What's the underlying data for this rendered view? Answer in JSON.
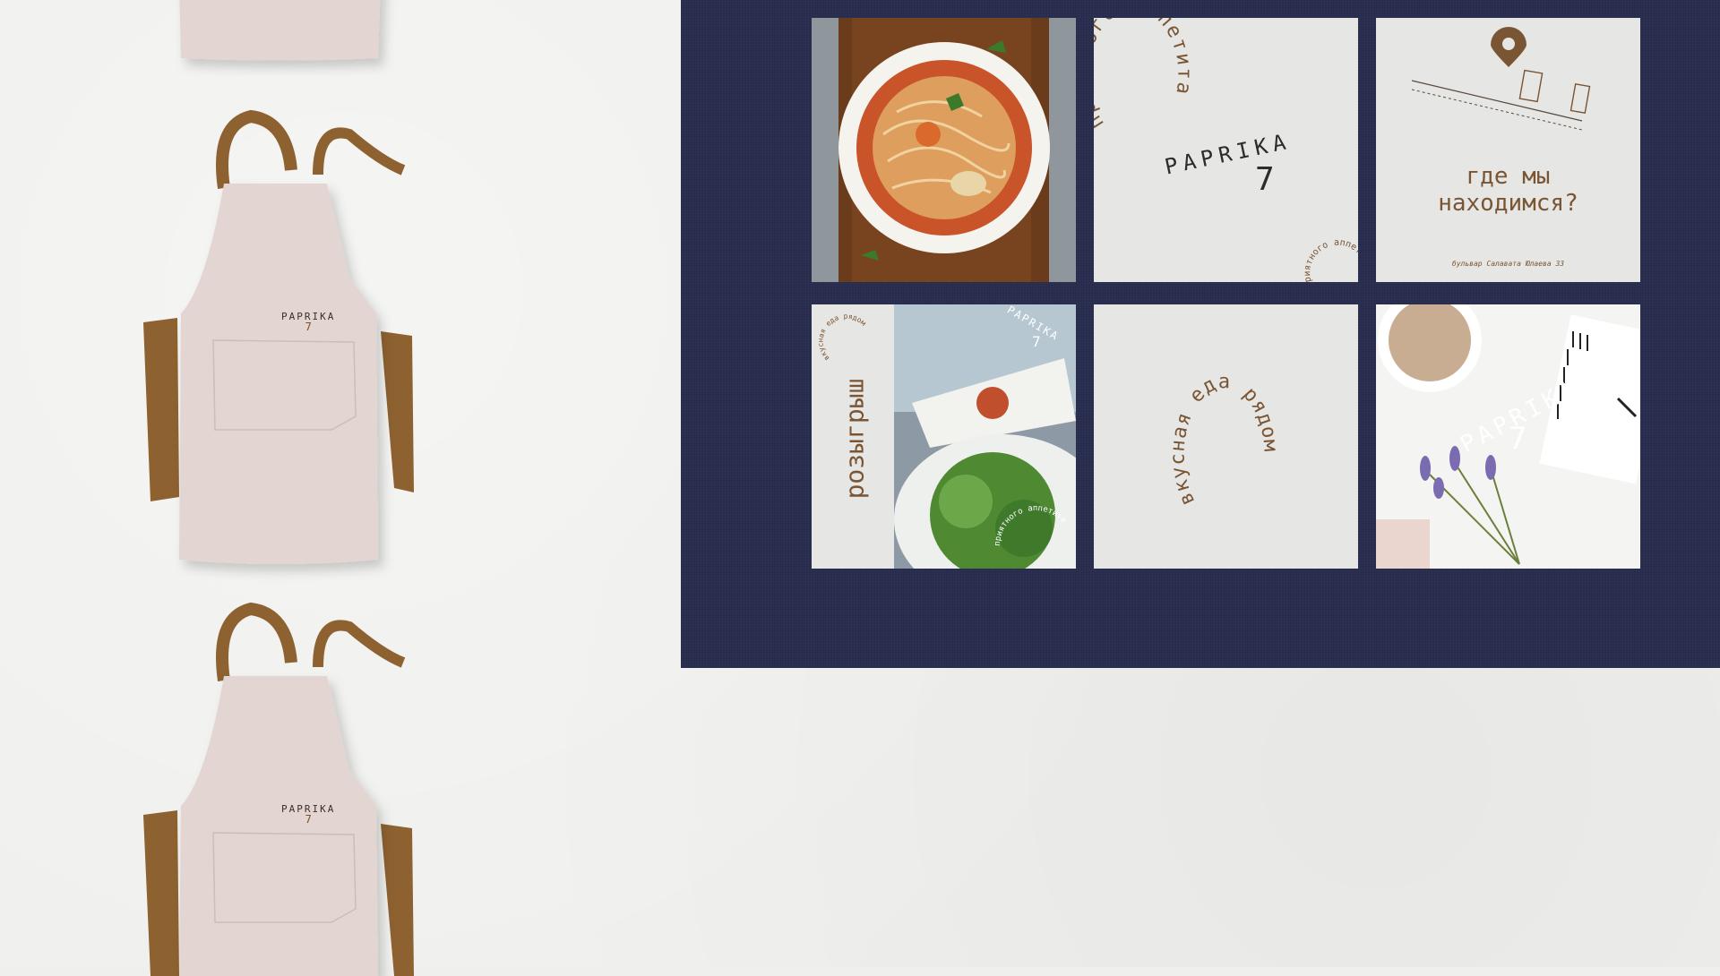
{
  "brand": {
    "word": "PAPRIKA",
    "number": "7",
    "colors": {
      "navy": "#272c4c",
      "brown": "#7a5533",
      "strap": "#8d6130",
      "apron": "#e3d5d2",
      "tile": "#e6e6e4"
    }
  },
  "aprons": [
    {
      "logo_word": "PAPRIKA",
      "logo_number": "7"
    },
    {
      "logo_word": "PAPRIKA",
      "logo_number": "7"
    },
    {
      "logo_word": "PAPRIKA",
      "logo_number": "7"
    }
  ],
  "tiles": {
    "noodle_photo": {
      "image": "noodle-soup-bowl-on-wooden-board"
    },
    "logo_tile": {
      "arc_text": "приятного аппетита",
      "arc_small": "приятного аппетита",
      "word": "PAPRIKA",
      "number": "7"
    },
    "location_tile": {
      "question_line1": "где мы",
      "question_line2": "находимся?",
      "address": "бульвар Салавата Юлаева 33",
      "icon": "map-pin-icon"
    },
    "giveaway_tile": {
      "vertical_text": "розыгрыш",
      "small_arc": "вкусная еда рядом",
      "logo_word": "PAPRIKA",
      "logo_number": "7",
      "photo_arc": "приятного аппетита",
      "image": "salad-plates-photo"
    },
    "slogan_tile": {
      "text": "вкусная еда рядом"
    },
    "lavender_tile": {
      "logo_word": "PAPRIKA",
      "logo_number": "7",
      "image": "coffee-lavender-notebook-photo"
    }
  }
}
